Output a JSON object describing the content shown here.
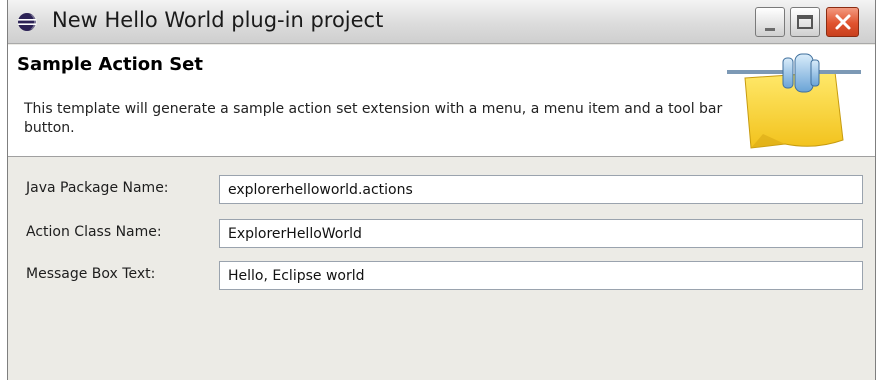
{
  "window": {
    "title": "New Hello World plug-in project"
  },
  "banner": {
    "title": "Sample Action Set",
    "description": "This template will generate a sample action set extension with a menu, a menu item and a tool bar button."
  },
  "form": {
    "fields": [
      {
        "label": "Java Package Name:",
        "value": "explorerhelloworld.actions"
      },
      {
        "label": "Action Class Name:",
        "value": "ExplorerHelloWorld"
      },
      {
        "label": "Message Box Text:",
        "value": "Hello, Eclipse world"
      }
    ]
  },
  "icons": {
    "title": "eclipse-icon",
    "banner": "plug-in-wizard-graphic",
    "minimize": "minimize-icon",
    "maximize": "maximize-icon",
    "close": "close-icon"
  },
  "colors": {
    "close_button": "#e0532e",
    "dialog_background": "#ecebe6",
    "field_border": "#9aa3ae"
  }
}
